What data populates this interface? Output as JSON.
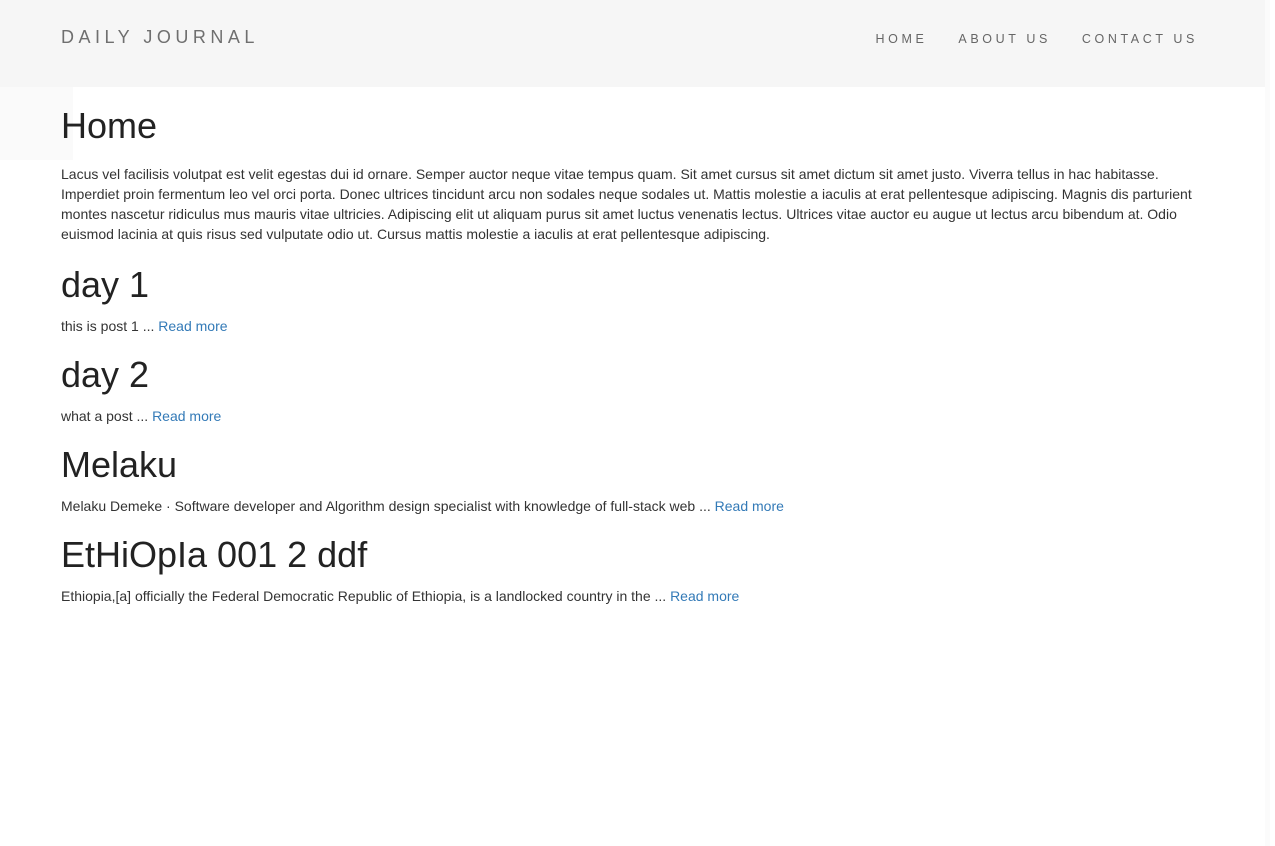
{
  "header": {
    "brand": "DAILY JOURNAL",
    "nav": [
      {
        "label": "HOME"
      },
      {
        "label": "ABOUT US"
      },
      {
        "label": "CONTACT US"
      }
    ]
  },
  "main": {
    "title": "Home",
    "intro": "Lacus vel facilisis volutpat est velit egestas dui id ornare. Semper auctor neque vitae tempus quam. Sit amet cursus sit amet dictum sit amet justo. Viverra tellus in hac habitasse. Imperdiet proin fermentum leo vel orci porta. Donec ultrices tincidunt arcu non sodales neque sodales ut. Mattis molestie a iaculis at erat pellentesque adipiscing. Magnis dis parturient montes nascetur ridiculus mus mauris vitae ultricies. Adipiscing elit ut aliquam purus sit amet luctus venenatis lectus. Ultrices vitae auctor eu augue ut lectus arcu bibendum at. Odio euismod lacinia at quis risus sed vulputate odio ut. Cursus mattis molestie a iaculis at erat pellentesque adipiscing.",
    "posts": [
      {
        "title": "day 1",
        "excerpt": "this is post 1 ...",
        "link": "Read more"
      },
      {
        "title": "day 2",
        "excerpt": "what a post ...",
        "link": "Read more"
      },
      {
        "title": "Melaku",
        "excerpt": "Melaku Demeke · Software developer and Algorithm design specialist with knowledge of full-stack web ...",
        "link": "Read more"
      },
      {
        "title": "EtHiOpIa 001 2 ddf",
        "excerpt": "Ethiopia,[a] officially the Federal Democratic Republic of Ethiopia, is a landlocked country in the ...",
        "link": "Read more"
      }
    ]
  },
  "colors": {
    "navbar_bg": "#f6f6f6",
    "link": "#337ab7",
    "text": "#333333"
  }
}
